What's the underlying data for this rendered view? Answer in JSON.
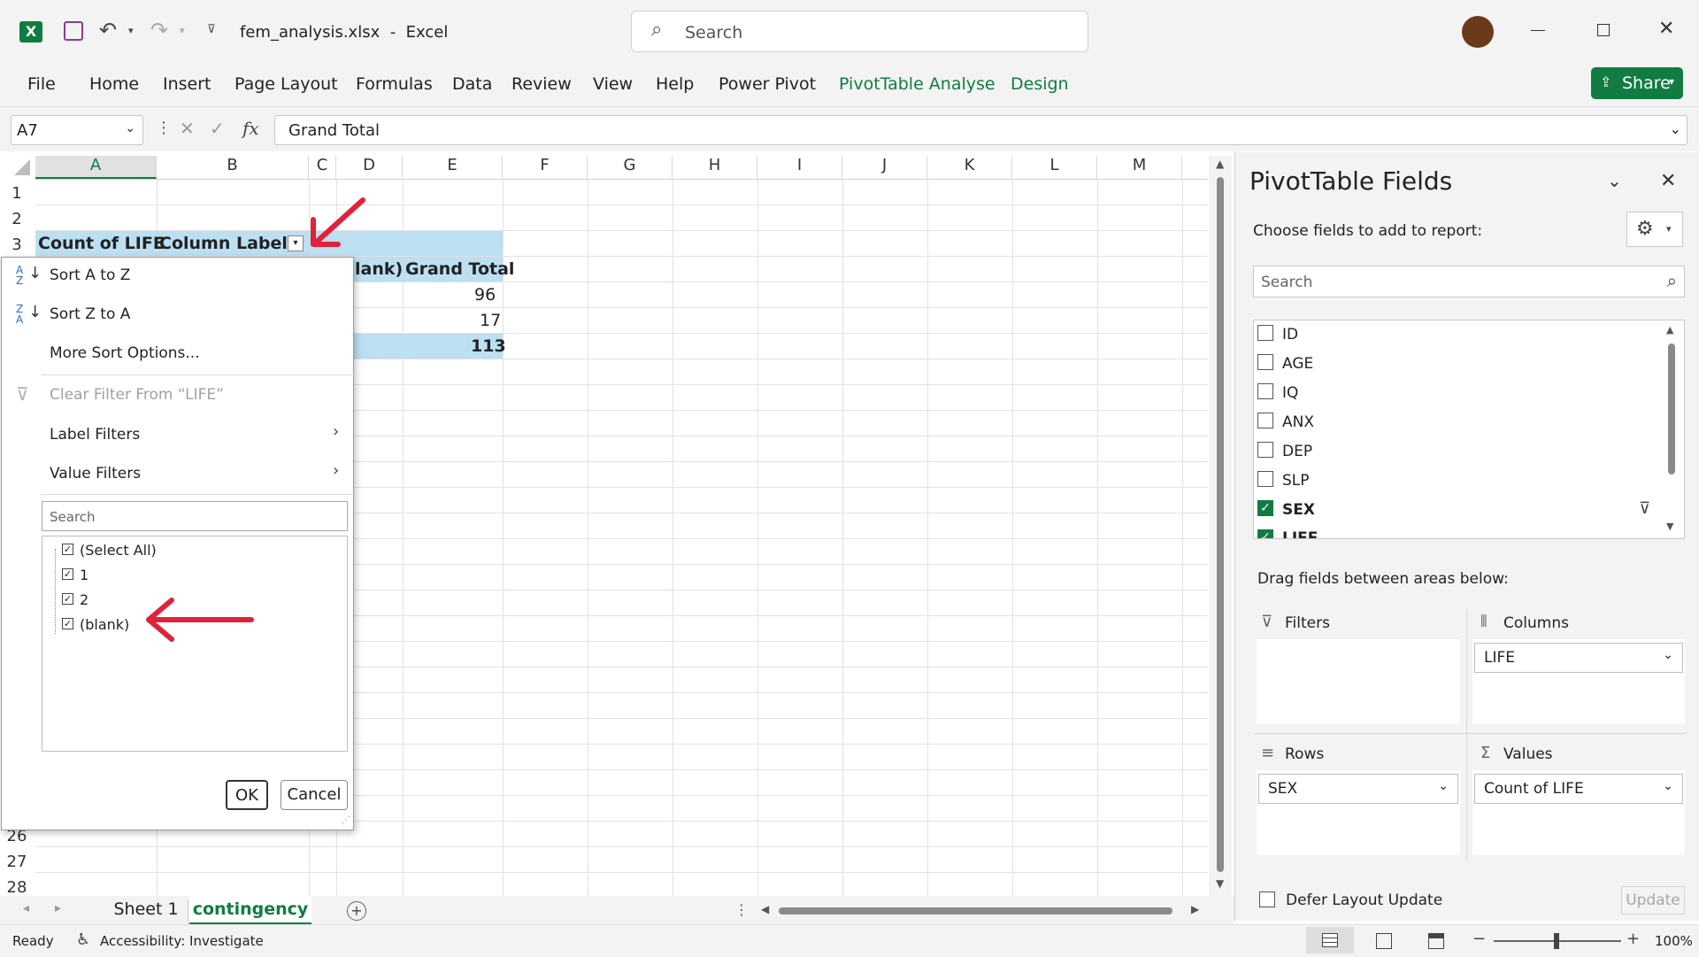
{
  "window": {
    "filename": "fem_analysis.xlsx",
    "separator": "-",
    "app": "Excel"
  },
  "search": {
    "placeholder": "Search"
  },
  "ribbon": {
    "tabs": [
      "File",
      "Home",
      "Insert",
      "Page Layout",
      "Formulas",
      "Data",
      "Review",
      "View",
      "Help",
      "Power Pivot",
      "PivotTable Analyse",
      "Design"
    ],
    "share_label": "Share"
  },
  "formula_bar": {
    "name_box": "A7",
    "fx": "fx",
    "value": "Grand Total"
  },
  "columns": [
    "A",
    "B",
    "C",
    "D",
    "E",
    "F",
    "G",
    "H",
    "I",
    "J",
    "K",
    "L",
    "M"
  ],
  "rows": [
    "1",
    "2",
    "3",
    "26",
    "27",
    "28"
  ],
  "cells": {
    "count_of_life": "Count of LIFE",
    "column_labels": "Column Labels",
    "blank_header": "lank)",
    "grand_total_header": "Grand Total",
    "v1": "96",
    "v2": "17",
    "total": "113"
  },
  "dropdown": {
    "sort_az": "Sort A to Z",
    "sort_za": "Sort Z to A",
    "more_sort": "More Sort Options...",
    "clear_filter": "Clear Filter From “LIFE”",
    "label_filters": "Label Filters",
    "value_filters": "Value Filters",
    "search_placeholder": "Search",
    "items": [
      "(Select All)",
      "1",
      "2",
      "(blank)"
    ],
    "ok": "OK",
    "cancel": "Cancel"
  },
  "sheets": {
    "tab1": "Sheet 1",
    "tab2": "contingency"
  },
  "pivot_panel": {
    "title": "PivotTable Fields",
    "choose": "Choose fields to add to report:",
    "search_placeholder": "Search",
    "fields": [
      {
        "name": "ID",
        "checked": false
      },
      {
        "name": "AGE",
        "checked": false
      },
      {
        "name": "IQ",
        "checked": false
      },
      {
        "name": "ANX",
        "checked": false
      },
      {
        "name": "DEP",
        "checked": false
      },
      {
        "name": "SLP",
        "checked": false
      },
      {
        "name": "SEX",
        "checked": true
      },
      {
        "name": "LIFE",
        "checked": true
      }
    ],
    "drag_text": "Drag fields between areas below:",
    "filters_label": "Filters",
    "columns_label": "Columns",
    "rows_label": "Rows",
    "values_label": "Values",
    "columns_value": "LIFE",
    "rows_value": "SEX",
    "values_value": "Count of LIFE",
    "defer_label": "Defer Layout Update",
    "update_label": "Update"
  },
  "status": {
    "ready": "Ready",
    "accessibility": "Accessibility: Investigate",
    "zoom": "100%"
  },
  "colors": {
    "excel_green": "#107c41",
    "pivot_blue": "#bcdff2",
    "arrow_red": "#e0223a"
  }
}
